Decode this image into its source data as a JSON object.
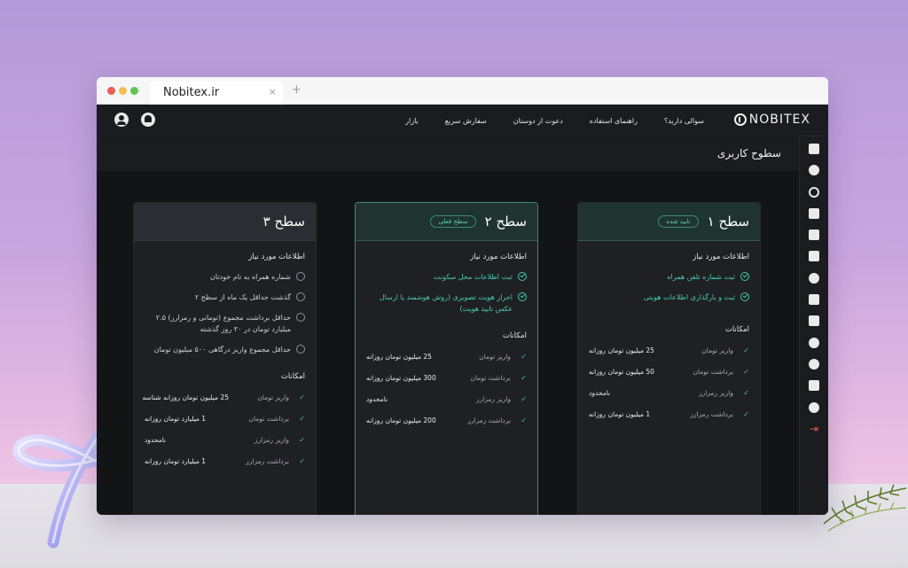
{
  "browser": {
    "tab_title": "Nobitex.ir",
    "close_glyph": "×",
    "new_tab_glyph": "+"
  },
  "app": {
    "logo_text": "NOBITEX",
    "nav": [
      "بازار",
      "سفارش سریع",
      "دعوت از دوستان",
      "راهنمای استفاده",
      "سوالی دارید؟"
    ],
    "page_title": "سطوح کاربری",
    "accent_color": "#3fc9a8"
  },
  "sidebar_icons": [
    "dashboard-icon",
    "markets-icon",
    "exchange-icon",
    "wallet-icon",
    "chart-icon",
    "orders-icon",
    "currency-icon",
    "profile-icon",
    "calendar-icon",
    "security-icon",
    "flash-icon",
    "mail-icon",
    "add-user-icon",
    "logout-icon"
  ],
  "levels": [
    {
      "title": "سطح ۱",
      "badge": "تایید شده",
      "requirements_title": "اطلاعات مورد نیاز",
      "requirements": [
        {
          "text": "ثبت شماره تلفن همراه",
          "done": true
        },
        {
          "text": "ثبت و بارگذاری اطلاعات هویتی",
          "done": true
        }
      ],
      "features_title": "امکانات",
      "features": [
        {
          "label": "واریز تومان",
          "value": "25 میلیون تومان روزانه"
        },
        {
          "label": "برداشت تومان",
          "value": "50 میلیون تومان روزانه"
        },
        {
          "label": "واریز رمزارز",
          "value": "نامحدود"
        },
        {
          "label": "برداشت رمزارز",
          "value": "1 میلیون تومان روزانه"
        }
      ]
    },
    {
      "title": "سطح ۲",
      "badge": "سطح فعلی",
      "requirements_title": "اطلاعات مورد نیاز",
      "requirements": [
        {
          "text": "ثبت اطلاعات محل سکونت",
          "done": true
        },
        {
          "text": "احراز هویت تصویری (روش هوشمند یا ارسال عکس تایید هویت)",
          "done": true
        }
      ],
      "features_title": "امکانات",
      "features": [
        {
          "label": "واریز تومان",
          "value": "25 میلیون تومان روزانه"
        },
        {
          "label": "برداشت تومان",
          "value": "300 میلیون تومان روزانه"
        },
        {
          "label": "واریز رمزارز",
          "value": "نامحدود"
        },
        {
          "label": "برداشت رمزارز",
          "value": "200 میلیون تومان روزانه"
        }
      ]
    },
    {
      "title": "سطح ۳",
      "badge": "",
      "requirements_title": "اطلاعات مورد نیاز",
      "requirements": [
        {
          "text": "شماره همراه به نام خودتان",
          "done": false
        },
        {
          "text": "گذشت حداقل یک ماه از سطح ۲",
          "done": false
        },
        {
          "text": "حداقل برداشت مجموع (تومانی و رمزارز) ۲.۵ میلیارد تومان در ۳۰ روز گذشته",
          "done": false
        },
        {
          "text": "حداقل مجموع واریز درگاهی ۵۰۰ میلیون تومان",
          "done": false
        }
      ],
      "features_title": "امکانات",
      "features": [
        {
          "label": "واریز تومان",
          "value": "25 میلیون تومان روزانه شناسه"
        },
        {
          "label": "برداشت تومان",
          "value": "1 میلیارد تومان روزانه"
        },
        {
          "label": "واریز رمزارز",
          "value": "نامحدود"
        },
        {
          "label": "برداشت رمزارز",
          "value": "1 میلیارد تومان روزانه"
        }
      ]
    }
  ]
}
